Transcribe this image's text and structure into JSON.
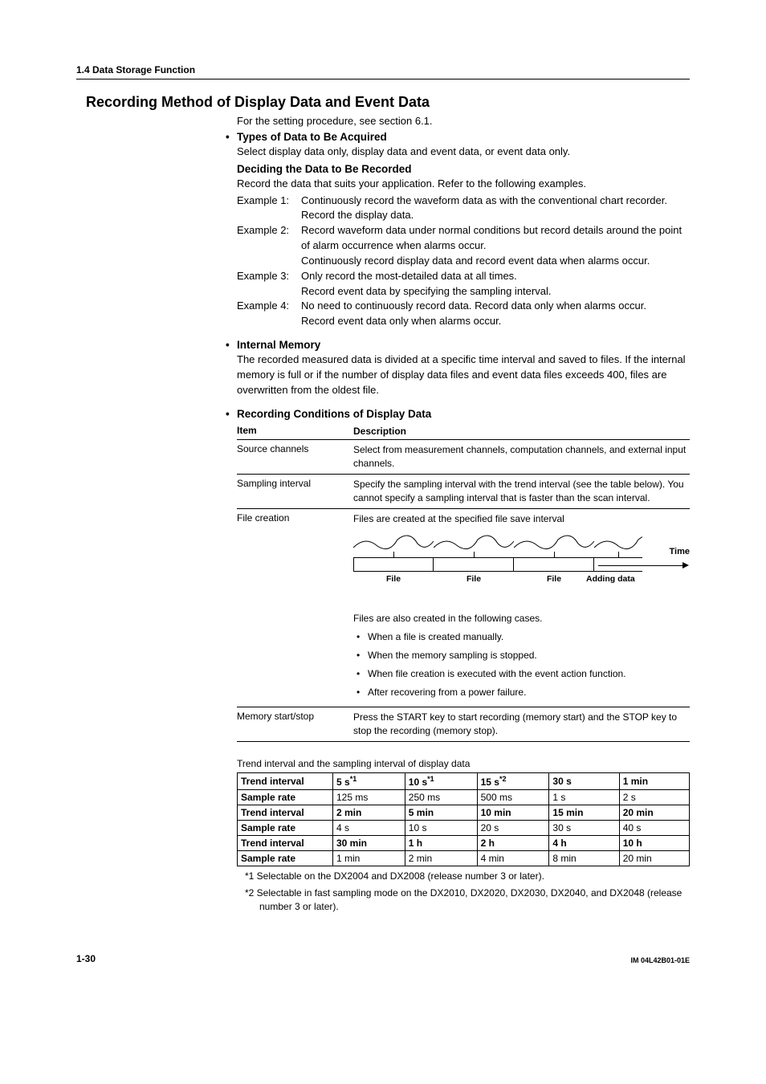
{
  "header": {
    "section": "1.4  Data Storage Function"
  },
  "title": "Recording Method of Display Data and Event Data",
  "intro": "For the setting procedure, see section 6.1.",
  "types": {
    "heading": "Types of Data to Be Acquired",
    "text": "Select display data only, display data and event data, or event data only.",
    "sub_heading": "Deciding the Data to Be Recorded",
    "sub_text": "Record the data that suits your application. Refer to the following examples.",
    "examples": [
      {
        "label": "Example 1:",
        "body": "Continuously record the waveform data as with the conventional chart recorder.\nRecord the display data."
      },
      {
        "label": "Example 2:",
        "body": "Record waveform data under normal conditions but record details around the point of alarm occurrence when alarms occur.\nContinuously record display data and record event data when alarms occur."
      },
      {
        "label": "Example 3:",
        "body": "Only record the most-detailed data at all times.\nRecord event data by specifying the sampling interval."
      },
      {
        "label": "Example 4:",
        "body": "No need to continuously record data. Record data only when alarms occur.\nRecord event data only when alarms occur."
      }
    ]
  },
  "internal_memory": {
    "heading": "Internal Memory",
    "text": "The recorded measured data is divided at a specific time interval and saved to files. If the internal memory is full or if the number of display data files and event data files exceeds 400, files are overwritten from the oldest file."
  },
  "recording_conditions": {
    "heading": "Recording Conditions of Display Data",
    "header_item": "Item",
    "header_desc": "Description",
    "rows": [
      {
        "item": "Source channels",
        "desc": "Select from measurement channels, computation channels, and external input channels."
      },
      {
        "item": "Sampling interval",
        "desc": "Specify the sampling interval with the trend interval (see the table below). You cannot specify a sampling interval that is faster than the scan interval."
      },
      {
        "item": "File creation",
        "desc_top": "Files are created at the specified file save interval",
        "diagram": {
          "file": "File",
          "adding": "Adding data",
          "time": "Time"
        },
        "desc_mid": "Files are also created in the following cases.",
        "bullets": [
          "When a file is created manually.",
          "When the memory sampling is stopped.",
          "When file creation is executed with the event action function.",
          "After recovering from a power failure."
        ]
      },
      {
        "item": "Memory start/stop",
        "desc": "Press the START key to start recording (memory start) and the STOP key to stop the recording (memory stop)."
      }
    ]
  },
  "trend_table": {
    "caption": "Trend interval and the sampling interval of display data",
    "rows": [
      {
        "label": "Trend interval",
        "c": [
          "5 s",
          "10 s",
          "15 s",
          "30 s",
          "1 min"
        ],
        "sup": [
          "*1",
          "*1",
          "*2",
          "",
          ""
        ],
        "bold": true
      },
      {
        "label": "Sample rate",
        "c": [
          "125 ms",
          "250 ms",
          "500 ms",
          "1 s",
          "2 s"
        ]
      },
      {
        "label": "Trend interval",
        "c": [
          "2 min",
          "5 min",
          "10 min",
          "15 min",
          "20 min"
        ],
        "bold": true
      },
      {
        "label": "Sample rate",
        "c": [
          "4 s",
          "10 s",
          "20 s",
          "30 s",
          "40 s"
        ]
      },
      {
        "label": "Trend interval",
        "c": [
          "30 min",
          "1 h",
          "2 h",
          "4 h",
          "10 h"
        ],
        "bold": true
      },
      {
        "label": "Sample rate",
        "c": [
          "1 min",
          "2 min",
          "4 min",
          "8 min",
          "20 min"
        ]
      }
    ],
    "footnotes": [
      "*1  Selectable on the DX2004 and DX2008 (release number 3 or later).",
      "*2  Selectable in fast sampling mode on the DX2010, DX2020, DX2030, DX2040, and DX2048 (release number 3 or later)."
    ]
  },
  "footer": {
    "page": "1-30",
    "docid": "IM 04L42B01-01E"
  }
}
